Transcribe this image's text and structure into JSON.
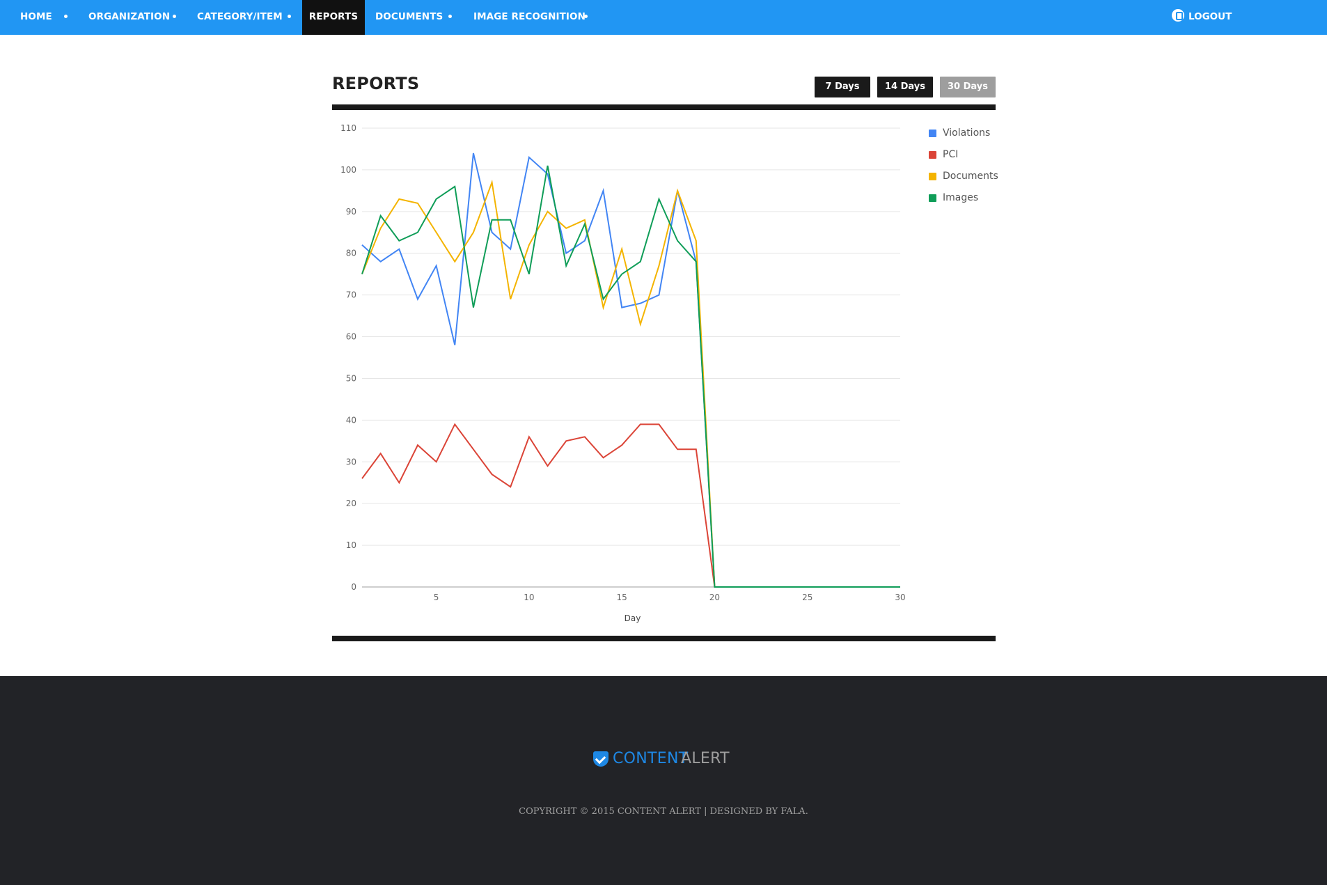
{
  "nav": {
    "items": [
      {
        "label": "HOME"
      },
      {
        "label": "ORGANIZATION"
      },
      {
        "label": "CATEGORY/ITEM"
      },
      {
        "label": "REPORTS",
        "active": true
      },
      {
        "label": "DOCUMENTS"
      },
      {
        "label": "IMAGE RECOGNITION"
      }
    ],
    "logout_label": "LOGOUT",
    "logout_icon": "power-icon"
  },
  "page": {
    "title": "REPORTS"
  },
  "range_buttons": [
    {
      "label": "7 Days",
      "active": false
    },
    {
      "label": "14 Days",
      "active": false
    },
    {
      "label": "30 Days",
      "active": true
    }
  ],
  "colors": {
    "nav_bg": "#2196f3",
    "active_nav_bg": "#111111",
    "footer_bg": "#222327",
    "violations": "#4285f4",
    "pci": "#db4437",
    "documents": "#f4b400",
    "images": "#0f9d58"
  },
  "chart_data": {
    "type": "line",
    "title": "",
    "xlabel": "Day",
    "ylabel": "",
    "xlim": [
      1,
      30
    ],
    "ylim": [
      0,
      110
    ],
    "yticks": [
      0,
      10,
      20,
      30,
      40,
      50,
      60,
      70,
      80,
      90,
      100,
      110
    ],
    "xticks": [
      5,
      10,
      15,
      20,
      25,
      30
    ],
    "grid": true,
    "legend": "right",
    "x": [
      1,
      2,
      3,
      4,
      5,
      6,
      7,
      8,
      9,
      10,
      11,
      12,
      13,
      14,
      15,
      16,
      17,
      18,
      19,
      20,
      21,
      22,
      23,
      24,
      25,
      26,
      27,
      28,
      29,
      30
    ],
    "series": [
      {
        "name": "Violations",
        "values": [
          82,
          78,
          81,
          69,
          77,
          58,
          104,
          85,
          81,
          103,
          99,
          80,
          83,
          95,
          67,
          68,
          70,
          95,
          78,
          0,
          0,
          0,
          0,
          0,
          0,
          0,
          0,
          0,
          0,
          0
        ]
      },
      {
        "name": "PCI",
        "values": [
          26,
          32,
          25,
          34,
          30,
          39,
          33,
          27,
          24,
          36,
          29,
          35,
          36,
          31,
          34,
          39,
          39,
          33,
          33,
          0,
          0,
          0,
          0,
          0,
          0,
          0,
          0,
          0,
          0,
          0
        ]
      },
      {
        "name": "Documents",
        "values": [
          75,
          86,
          93,
          92,
          85,
          78,
          85,
          97,
          69,
          82,
          90,
          86,
          88,
          67,
          81,
          63,
          77,
          95,
          83,
          0,
          0,
          0,
          0,
          0,
          0,
          0,
          0,
          0,
          0,
          0
        ]
      },
      {
        "name": "Images",
        "values": [
          75,
          89,
          83,
          85,
          93,
          96,
          67,
          88,
          88,
          75,
          101,
          77,
          87,
          69,
          75,
          78,
          93,
          83,
          78,
          0,
          0,
          0,
          0,
          0,
          0,
          0,
          0,
          0,
          0,
          0
        ]
      }
    ]
  },
  "footer": {
    "logo_part1": "CONTENT",
    "logo_part2": "ALERT",
    "copyright": "COPYRIGHT © 2015 CONTENT ALERT | DESIGNED BY FALA."
  }
}
